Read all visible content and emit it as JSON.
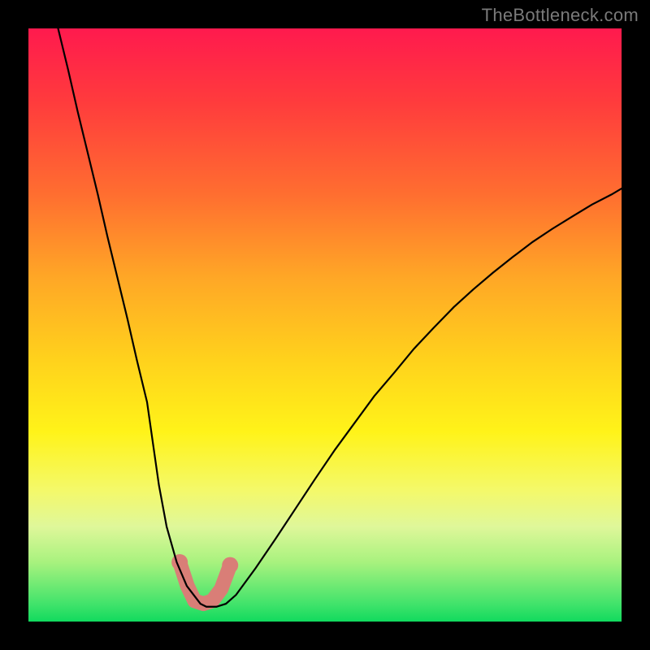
{
  "watermark": {
    "text": "TheBottleneck.com"
  },
  "chart_data": {
    "type": "line",
    "title": "",
    "xlabel": "",
    "ylabel": "",
    "xlim": [
      0,
      100
    ],
    "ylim": [
      0,
      100
    ],
    "grid": false,
    "legend": false,
    "background": "rainbow-gradient-red-to-green",
    "series": [
      {
        "name": "bottleneck-curve",
        "color": "#000000",
        "x": [
          5.0,
          6.7,
          8.3,
          10.0,
          11.7,
          13.3,
          15.0,
          16.7,
          18.3,
          20.0,
          21.0,
          22.0,
          23.3,
          25.0,
          26.7,
          29.0,
          30.0,
          31.7,
          33.3,
          35.0,
          38.3,
          41.7,
          45.0,
          48.3,
          51.7,
          55.0,
          58.3,
          61.7,
          65.0,
          68.3,
          71.7,
          75.0,
          78.3,
          81.7,
          85.0,
          88.3,
          91.7,
          95.0,
          98.3,
          100.0
        ],
        "y": [
          100.0,
          93.0,
          86.0,
          79.0,
          72.0,
          65.0,
          58.0,
          51.0,
          44.0,
          37.0,
          30.0,
          23.0,
          16.0,
          10.0,
          6.0,
          3.0,
          2.5,
          2.5,
          3.0,
          4.5,
          9.0,
          14.0,
          19.0,
          24.0,
          29.0,
          33.5,
          38.0,
          42.0,
          46.0,
          49.5,
          53.0,
          56.0,
          58.8,
          61.5,
          64.0,
          66.2,
          68.3,
          70.3,
          72.0,
          73.0
        ]
      }
    ],
    "highlight_band": {
      "name": "optimal-range",
      "shape": "u",
      "color": "#d97e77",
      "stroke_width": 18,
      "x": [
        25.5,
        26.8,
        28.0,
        29.5,
        31.0,
        32.5,
        34.0
      ],
      "y": [
        10.0,
        6.0,
        3.5,
        3.0,
        3.5,
        5.5,
        9.5
      ]
    }
  }
}
